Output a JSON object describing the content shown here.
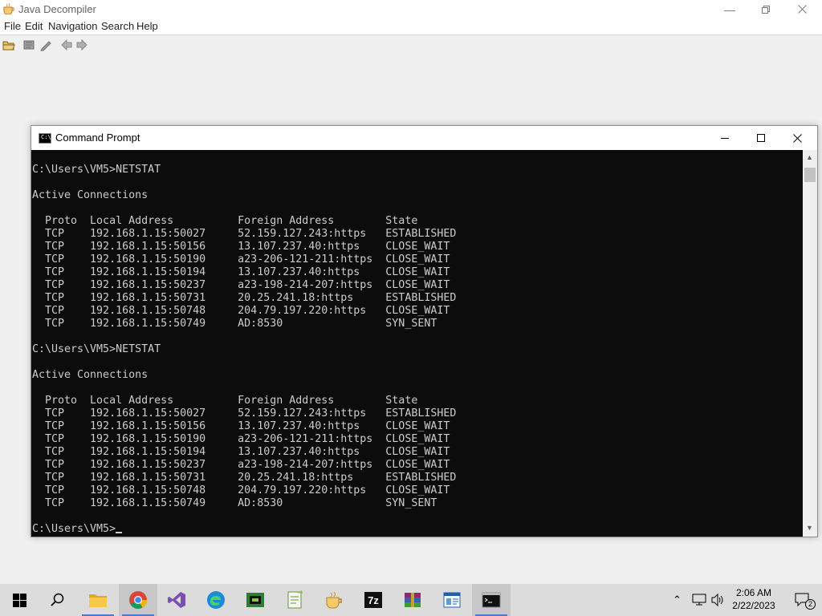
{
  "jd": {
    "title": "Java Decompiler",
    "menus": [
      "File",
      "Edit",
      "Navigation",
      "Search",
      "Help"
    ],
    "toolbar": [
      "open-file-icon",
      "open-type-icon",
      "edit-icon",
      "back-icon",
      "forward-icon"
    ]
  },
  "cmd": {
    "title": "Command Prompt",
    "lines": [
      "C:\\Users\\VM5>NETSTAT",
      "",
      "Active Connections",
      "",
      "  Proto  Local Address          Foreign Address        State",
      "  TCP    192.168.1.15:50027     52.159.127.243:https   ESTABLISHED",
      "  TCP    192.168.1.15:50156     13.107.237.40:https    CLOSE_WAIT",
      "  TCP    192.168.1.15:50190     a23-206-121-211:https  CLOSE_WAIT",
      "  TCP    192.168.1.15:50194     13.107.237.40:https    CLOSE_WAIT",
      "  TCP    192.168.1.15:50237     a23-198-214-207:https  CLOSE_WAIT",
      "  TCP    192.168.1.15:50731     20.25.241.18:https     ESTABLISHED",
      "  TCP    192.168.1.15:50748     204.79.197.220:https   CLOSE_WAIT",
      "  TCP    192.168.1.15:50749     AD:8530                SYN_SENT",
      "",
      "C:\\Users\\VM5>NETSTAT",
      "",
      "Active Connections",
      "",
      "  Proto  Local Address          Foreign Address        State",
      "  TCP    192.168.1.15:50027     52.159.127.243:https   ESTABLISHED",
      "  TCP    192.168.1.15:50156     13.107.237.40:https    CLOSE_WAIT",
      "  TCP    192.168.1.15:50190     a23-206-121-211:https  CLOSE_WAIT",
      "  TCP    192.168.1.15:50194     13.107.237.40:https    CLOSE_WAIT",
      "  TCP    192.168.1.15:50237     a23-198-214-207:https  CLOSE_WAIT",
      "  TCP    192.168.1.15:50731     20.25.241.18:https     ESTABLISHED",
      "  TCP    192.168.1.15:50748     204.79.197.220:https   CLOSE_WAIT",
      "  TCP    192.168.1.15:50749     AD:8530                SYN_SENT",
      ""
    ],
    "prompt": "C:\\Users\\VM5>"
  },
  "taskbar": {
    "apps": [
      "start-icon",
      "search-icon",
      "file-explorer-icon",
      "chrome-icon",
      "visual-studio-icon",
      "edge-icon",
      "app-icon",
      "notepad-plus-icon",
      "java-decompiler-icon",
      "seven-zip-icon",
      "winrar-icon",
      "app-window-icon",
      "command-prompt-icon"
    ],
    "time": "2:06 AM",
    "date": "2/22/2023",
    "notification_count": "2",
    "seven_zip_label": "7z"
  },
  "colors": {
    "console_bg": "#0c0c0c",
    "console_fg": "#cccccc",
    "taskbar_bg": "#dcdcdc",
    "accent": "#4a7ec0"
  }
}
